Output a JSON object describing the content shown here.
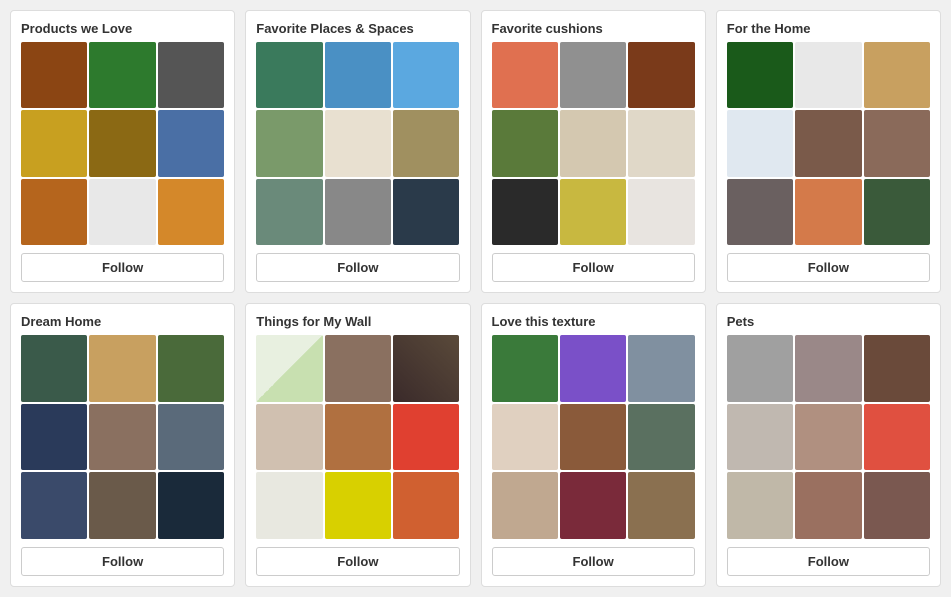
{
  "boards": [
    {
      "id": 0,
      "title": "Products we Love",
      "follow_label": "Follow"
    },
    {
      "id": 1,
      "title": "Favorite Places & Spaces",
      "follow_label": "Follow"
    },
    {
      "id": 2,
      "title": "Favorite cushions",
      "follow_label": "Follow"
    },
    {
      "id": 3,
      "title": "For the Home",
      "follow_label": "Follow"
    },
    {
      "id": 4,
      "title": "Dream Home",
      "follow_label": "Follow"
    },
    {
      "id": 5,
      "title": "Things for My Wall",
      "follow_label": "Follow"
    },
    {
      "id": 6,
      "title": "Love this texture",
      "follow_label": "Follow"
    },
    {
      "id": 7,
      "title": "Pets",
      "follow_label": "Follow"
    }
  ]
}
